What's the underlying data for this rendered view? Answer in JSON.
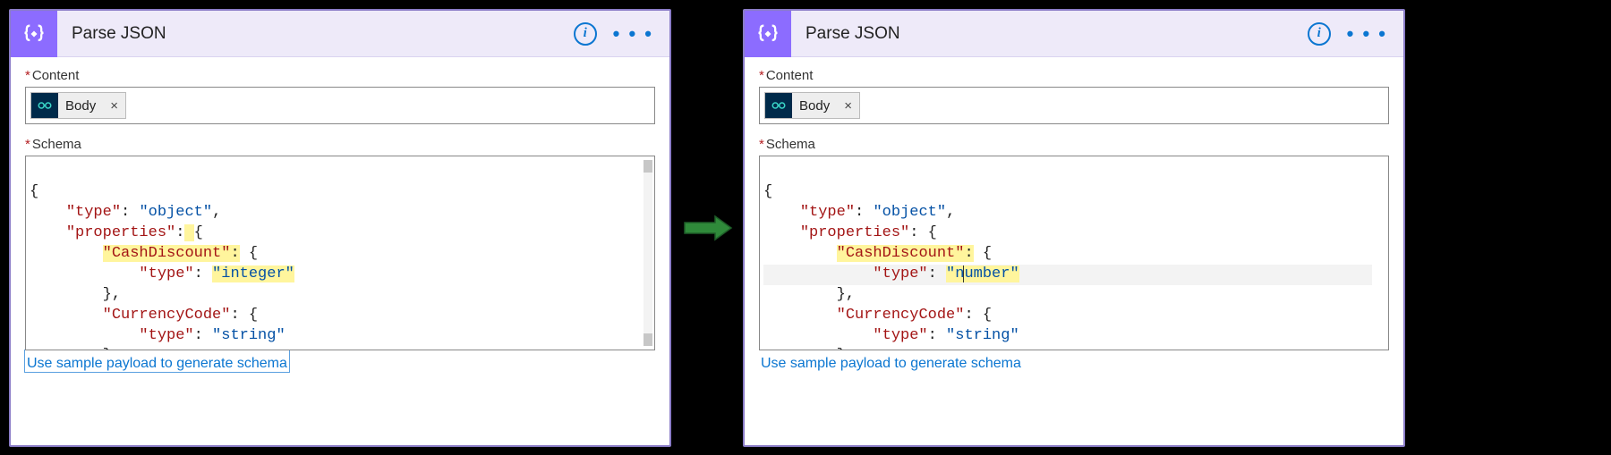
{
  "left": {
    "title": "Parse JSON",
    "info_glyph": "i",
    "dots_glyph": "• • •",
    "content_label": "Content",
    "content_token": "Body",
    "content_token_remove": "×",
    "schema_label": "Schema",
    "schema_lines": {
      "l0": "{",
      "l1_k": "\"type\"",
      "l1_v": "\"object\"",
      "l2_k": "\"properties\"",
      "l3_k": "\"CashDiscount\"",
      "l4_k": "\"type\"",
      "l4_v": "\"integer\"",
      "l5": "},",
      "l6_k": "\"CurrencyCode\"",
      "l7_k": "\"type\"",
      "l7_v": "\"string\"",
      "l8": "},"
    },
    "sample_link": "Use sample payload to generate schema"
  },
  "right": {
    "title": "Parse JSON",
    "info_glyph": "i",
    "dots_glyph": "• • •",
    "content_label": "Content",
    "content_token": "Body",
    "content_token_remove": "×",
    "schema_label": "Schema",
    "schema_lines": {
      "l0": "{",
      "l1_k": "\"type\"",
      "l1_v": "\"object\"",
      "l2_k": "\"properties\"",
      "l3_k": "\"CashDiscount\"",
      "l4_k": "\"type\"",
      "l4_va": "\"n",
      "l4_vb": "umber\"",
      "l5": "},",
      "l6_k": "\"CurrencyCode\"",
      "l7_k": "\"type\"",
      "l7_v": "\"string\"",
      "l8": "},"
    },
    "sample_link": "Use sample payload to generate schema"
  }
}
